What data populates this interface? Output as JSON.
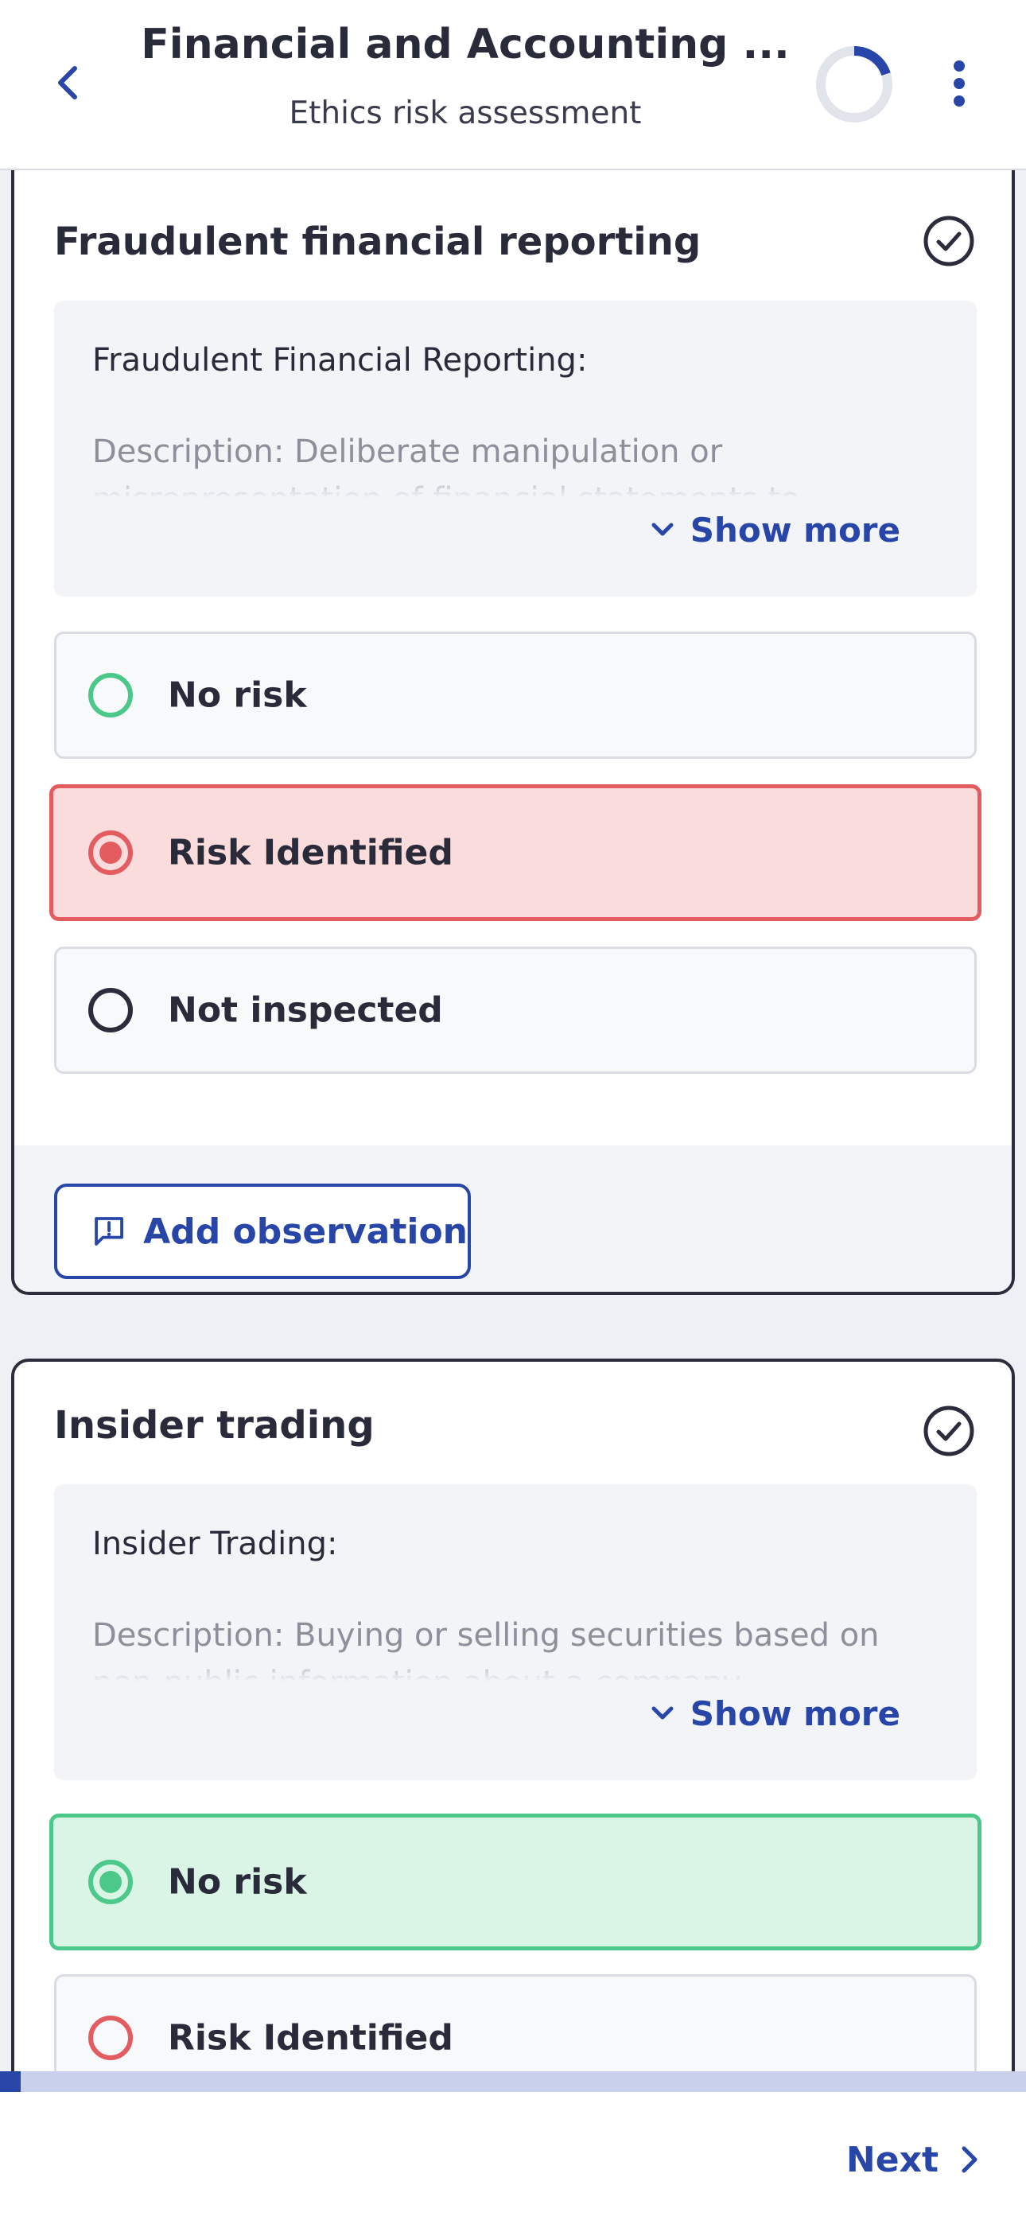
{
  "header": {
    "title": "Financial and Accounting ...",
    "subtitle": "Ethics risk assessment",
    "progress_fraction": 0.2
  },
  "cards": [
    {
      "title": "Fraudulent financial reporting",
      "description_heading": "Fraudulent Financial Reporting:",
      "description": "Description: Deliberate manipulation or misrepresentation of financial statements to",
      "show_more": "Show more",
      "options": [
        "No risk",
        "Risk Identified",
        "Not inspected"
      ],
      "selected": "Risk Identified",
      "add_observation": "Add observation"
    },
    {
      "title": "Insider trading",
      "description_heading": "Insider Trading:",
      "description": "Description: Buying or selling securities based on non-public information about a company",
      "show_more": "Show more",
      "options": [
        "No risk",
        "Risk Identified"
      ],
      "selected": "No risk"
    }
  ],
  "footer": {
    "next_label": "Next",
    "progress_fraction": 0.02
  },
  "colors": {
    "accent": "#2746a8",
    "risk": "#e25c60",
    "risk_bg": "#fbdcdc",
    "ok": "#4bc88a",
    "ok_bg": "#daf5e6",
    "neutral": "#2b2d3c"
  }
}
